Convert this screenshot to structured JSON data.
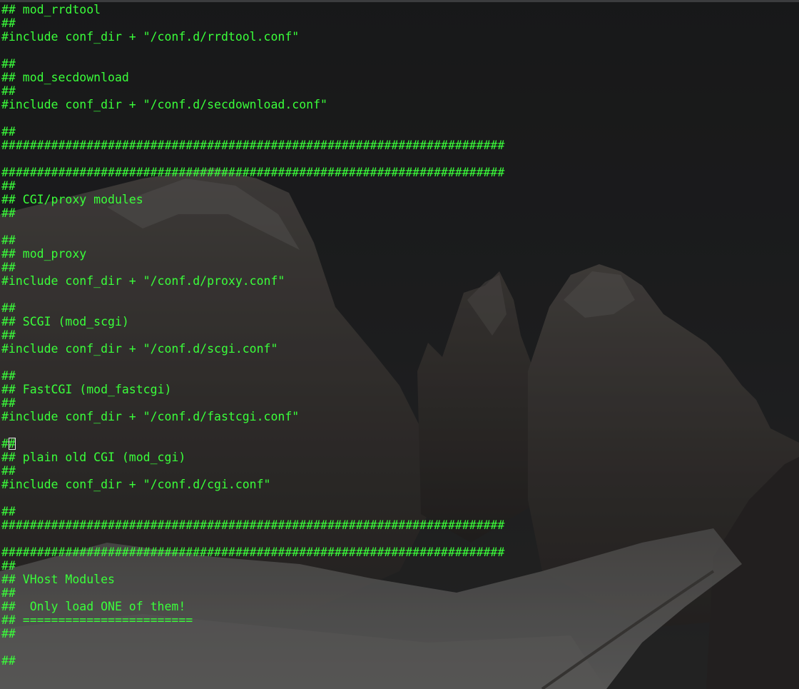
{
  "terminal": {
    "text_color": "#3aff3a",
    "cursor_line_index": 32,
    "lines": [
      "## mod_rrdtool",
      "##",
      "#include conf_dir + \"/conf.d/rrdtool.conf\"",
      "",
      "##",
      "## mod_secdownload",
      "##",
      "#include conf_dir + \"/conf.d/secdownload.conf\"",
      "",
      "##",
      "#######################################################################",
      "",
      "#######################################################################",
      "##",
      "## CGI/proxy modules",
      "##",
      "",
      "##",
      "## mod_proxy",
      "##",
      "#include conf_dir + \"/conf.d/proxy.conf\"",
      "",
      "##",
      "## SCGI (mod_scgi)",
      "##",
      "#include conf_dir + \"/conf.d/scgi.conf\"",
      "",
      "##",
      "## FastCGI (mod_fastcgi)",
      "##",
      "#include conf_dir + \"/conf.d/fastcgi.conf\"",
      "",
      "##",
      "## plain old CGI (mod_cgi)",
      "##",
      "#include conf_dir + \"/conf.d/cgi.conf\"",
      "",
      "##",
      "#######################################################################",
      "",
      "#######################################################################",
      "##",
      "## VHost Modules",
      "##",
      "##  Only load ONE of them!",
      "## ========================",
      "##",
      "",
      "##"
    ]
  }
}
